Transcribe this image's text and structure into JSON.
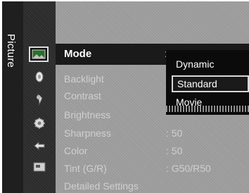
{
  "sidebar": {
    "title": "Picture"
  },
  "menu": {
    "mode": {
      "label": "Mode",
      "colon": ":"
    },
    "items": [
      {
        "label": "Backlight",
        "value": ""
      },
      {
        "label": "Contrast",
        "value": ""
      },
      {
        "label": "Brightness",
        "value": ""
      },
      {
        "label": "Sharpness",
        "value": ": 50"
      },
      {
        "label": "Color",
        "value": ": 50"
      },
      {
        "label": "Tint (G/R)",
        "value": ": G50/R50"
      },
      {
        "label": "Detailed Settings",
        "value": ""
      }
    ]
  },
  "dropdown": {
    "options": [
      "Dynamic",
      "Standard",
      "Movie"
    ],
    "selected": "Standard"
  },
  "icons": [
    "picture-icon",
    "sound-icon",
    "channel-icon",
    "setup-icon",
    "input-icon",
    "support-icon"
  ]
}
